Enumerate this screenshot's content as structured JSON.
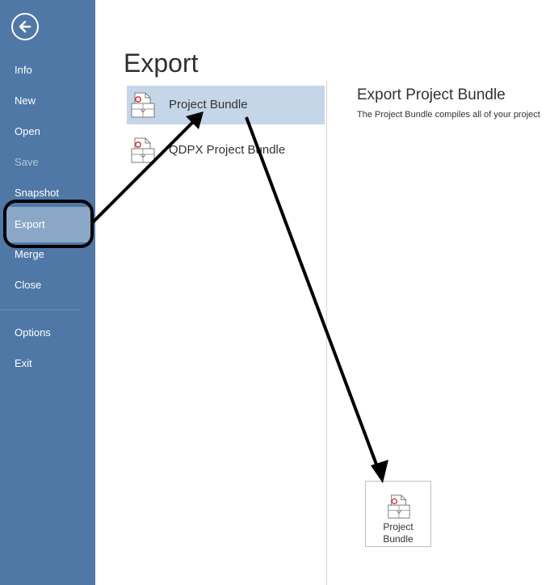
{
  "sidebar": {
    "back_icon": "back-arrow-icon",
    "items": [
      {
        "label": "Info"
      },
      {
        "label": "New"
      },
      {
        "label": "Open"
      },
      {
        "label": "Save"
      },
      {
        "label": "Snapshot"
      },
      {
        "label": "Export"
      },
      {
        "label": "Merge"
      },
      {
        "label": "Close"
      },
      {
        "label": "Options"
      },
      {
        "label": "Exit"
      }
    ],
    "selected": "Export",
    "disabled": "Save"
  },
  "main": {
    "title": "Export",
    "options": [
      {
        "label": "Project Bundle",
        "icon": "project-bundle-icon"
      },
      {
        "label": "QDPX Project Bundle",
        "icon": "qdpx-bundle-icon"
      }
    ],
    "detail": {
      "title": "Export Project Bundle",
      "description": "The Project Bundle compiles all of your project",
      "button_label": "Project\nBundle"
    }
  },
  "colors": {
    "sidebar_bg": "#4f78a6",
    "selected_nav": "#8aa7c8",
    "selected_option": "#c5d6e8",
    "annotation": "#000000"
  }
}
